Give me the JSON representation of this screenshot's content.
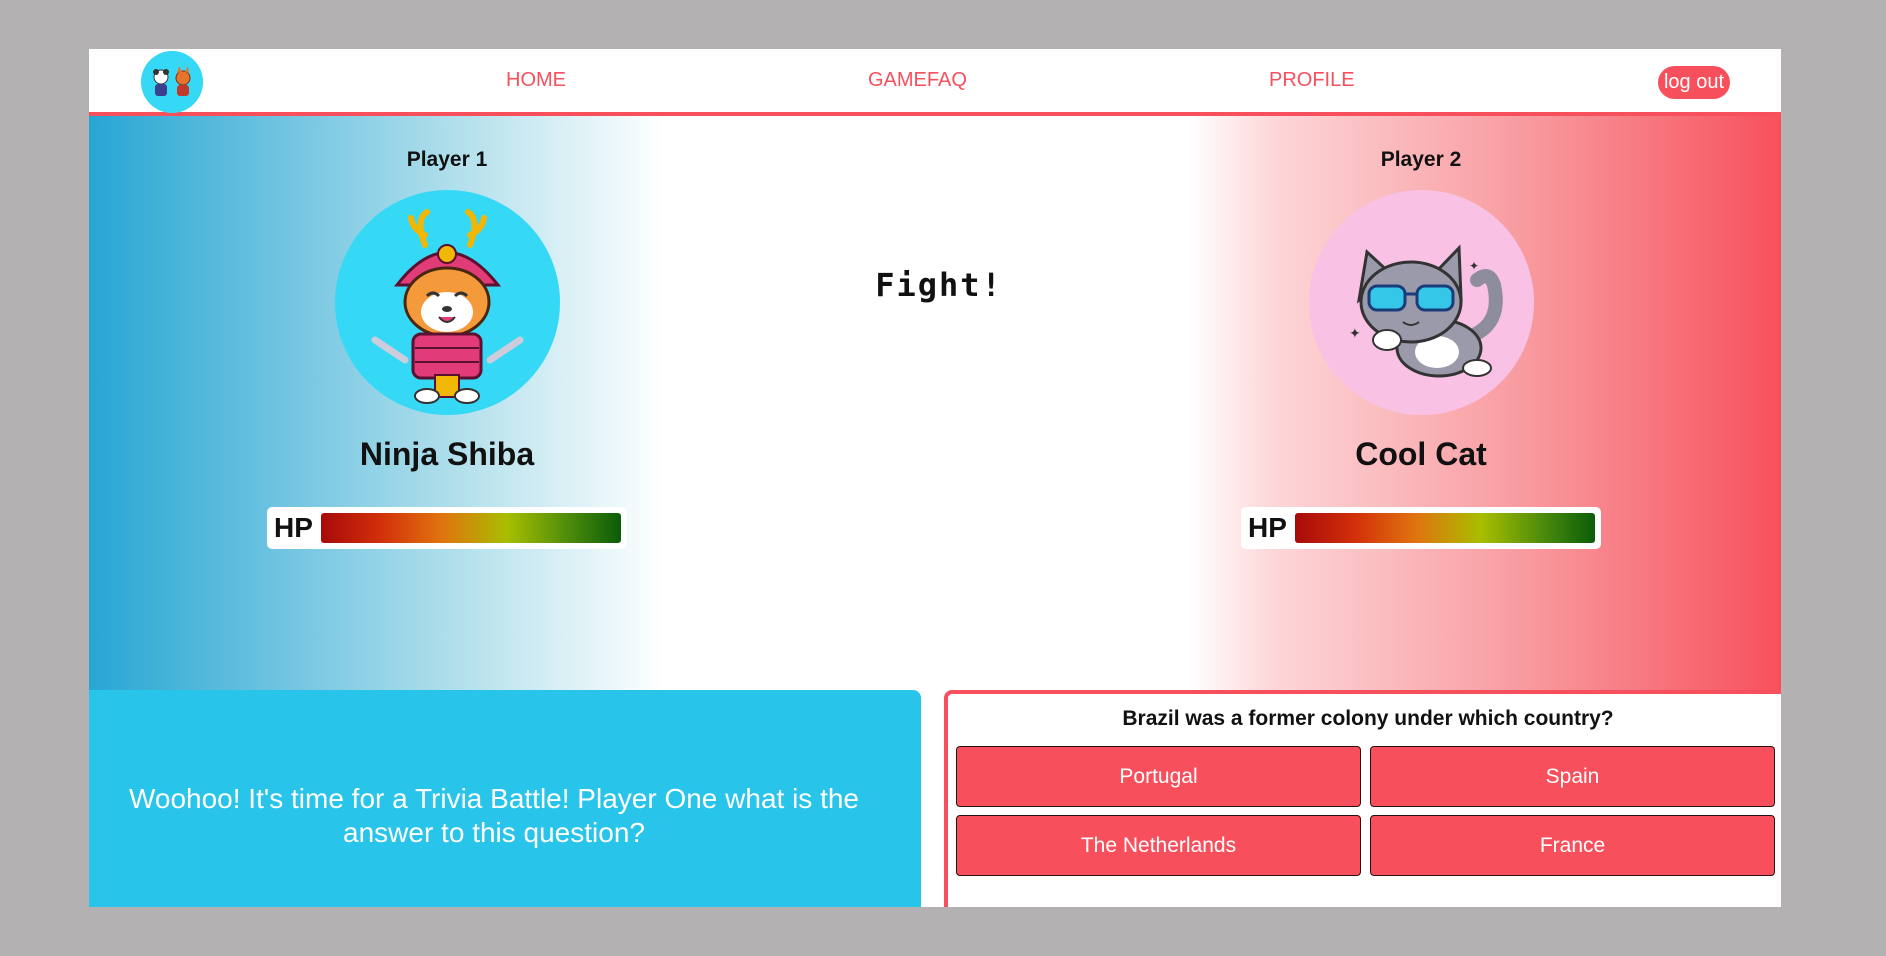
{
  "nav": {
    "links": [
      {
        "label": "HOME"
      },
      {
        "label": "GAMEFAQ"
      },
      {
        "label": "PROFILE"
      }
    ],
    "logout_label": "log out",
    "accent_color": "#f7505c"
  },
  "battle": {
    "status": "Fight!",
    "player1": {
      "label": "Player 1",
      "name": "Ninja Shiba",
      "hp_label": "HP",
      "hp_fraction": 1.0,
      "avatar_bg": "#35d9f6"
    },
    "player2": {
      "label": "Player 2",
      "name": "Cool Cat",
      "hp_label": "HP",
      "hp_fraction": 1.0,
      "avatar_bg": "#f9c1e4"
    }
  },
  "message": {
    "text": "Woohoo! It's time for a Trivia Battle! Player One what is the answer to this question?"
  },
  "question": {
    "text": "Brazil was a former colony under which country?",
    "answers": [
      "Portugal",
      "Spain",
      "The Netherlands",
      "France"
    ]
  }
}
